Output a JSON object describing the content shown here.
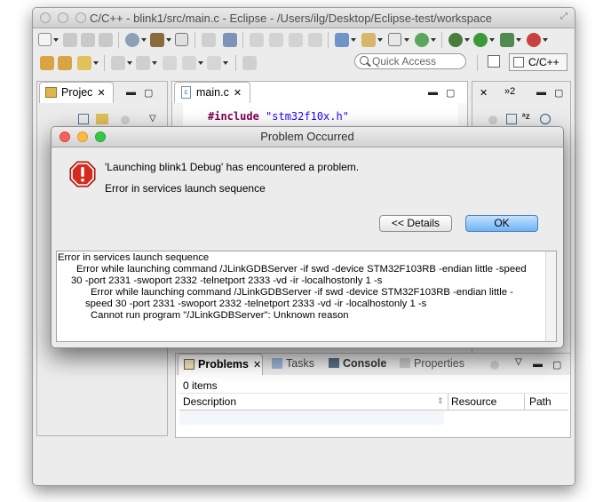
{
  "window": {
    "title": "C/C++ - blink1/src/main.c - Eclipse - /Users/ilg/Desktop/Eclipse-test/workspace"
  },
  "toolbar": {
    "quick_access_placeholder": "Quick Access",
    "perspective_label": "C/C++"
  },
  "project_explorer": {
    "tab_label": "Projec"
  },
  "editor": {
    "tab_label": "main.c",
    "code_line_directive": "#include",
    "code_line_string": "\"stm32f10x.h\""
  },
  "outline": {
    "tab_overflow_label": "»2"
  },
  "dialog": {
    "title": "Problem Occurred",
    "message": "'Launching blink1 Debug' has encountered a problem.",
    "reason": "Error in services launch sequence",
    "details_button": "<< Details",
    "ok_button": "OK",
    "details_lines": [
      "Error in services launch sequence",
      "Error while launching command /JLinkGDBServer -if swd -device STM32F103RB -endian little -speed",
      "30 -port 2331 -swoport 2332 -telnetport 2333 -vd -ir -localhostonly 1 -s",
      "Error while launching command /JLinkGDBServer -if swd -device STM32F103RB -endian little -",
      "speed 30 -port 2331 -swoport 2332 -telnetport 2333 -vd -ir -localhostonly 1 -s",
      "Cannot run program \"/JLinkGDBServer\": Unknown reason"
    ]
  },
  "bottom_panel": {
    "tabs": [
      "Problems",
      "Tasks",
      "Console",
      "Properties"
    ],
    "items_count": "0 items",
    "columns": [
      "Description",
      "Resource",
      "Path"
    ]
  },
  "colors": {
    "ok_button": "#6fb3f4",
    "error_icon": "#d42b1e",
    "keyword": "#7f0055",
    "string": "#2a00ff",
    "close_light": "#fc605b",
    "minimize_light": "#fdbc40",
    "zoom_light": "#34c84a"
  }
}
